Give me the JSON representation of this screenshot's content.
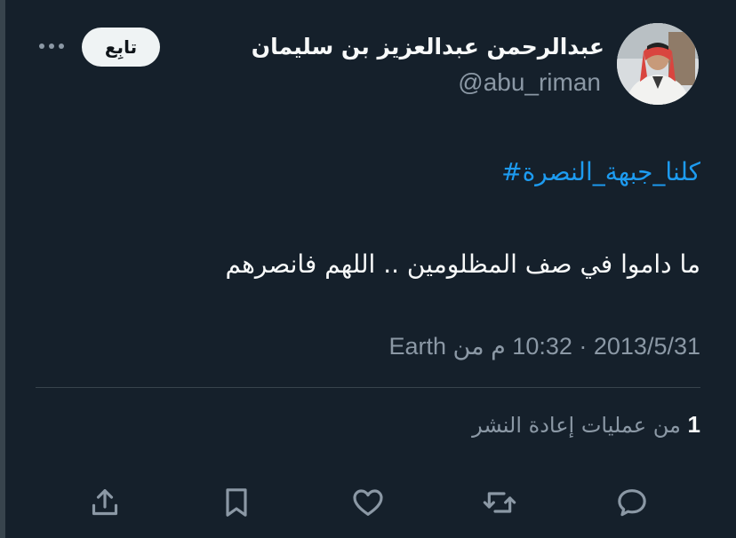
{
  "tweet": {
    "author": {
      "display_name": "عبدالرحمن عبدالعزيز بن سليمان",
      "handle": "@abu_riman"
    },
    "follow_label": "تابِع",
    "hashtag": "#كلنا_جبهة_النصرة",
    "text": "ما داموا في صف المظلومين .. اللهم فانصرهم",
    "meta": "2013/5/31 · 10:32 م من Earth",
    "stats": {
      "retweet_count": "1",
      "retweet_label": "من عمليات إعادة النشر"
    }
  },
  "icons": {
    "more": "more-dots-icon",
    "reply": "reply-icon",
    "retweet": "retweet-icon",
    "like": "heart-icon",
    "bookmark": "bookmark-icon",
    "share": "share-icon"
  },
  "colors": {
    "background": "#15202b",
    "text": "#f7f9f9",
    "secondary": "#8b98a5",
    "link": "#1d9bf0",
    "divider": "#38444d",
    "button_bg": "#eff3f4"
  }
}
